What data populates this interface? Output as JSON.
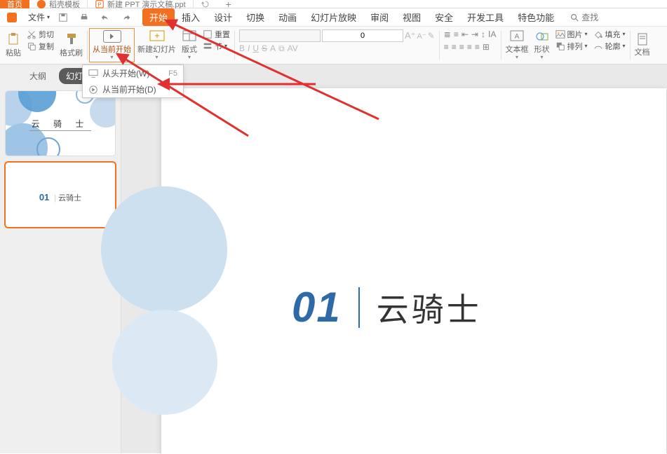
{
  "tabs": {
    "home": "首页",
    "template": "稻壳模板",
    "doc": "新建 PPT 演示文稿.ppt"
  },
  "filemenu": {
    "label": "文件"
  },
  "menutabs": {
    "start": "开始",
    "insert": "插入",
    "design": "设计",
    "transition": "切换",
    "animation": "动画",
    "slideshow": "幻灯片放映",
    "review": "审阅",
    "view": "视图",
    "security": "安全",
    "devtools": "开发工具",
    "special": "特色功能"
  },
  "search": {
    "label": "查找"
  },
  "ribbon": {
    "cut": "剪切",
    "copy": "复制",
    "paste": "粘贴",
    "format_painter": "格式刷",
    "from_current": "从当前开始",
    "new_slide": "新建幻灯片",
    "layout": "版式",
    "reset": "重置",
    "section": "节",
    "font_size": "0",
    "textbox": "文本框",
    "shapes": "形状",
    "picture": "图片",
    "arrange": "排列",
    "fill": "填充",
    "outline": "轮廓",
    "doc_assist": "文档"
  },
  "dropmenu": {
    "from_start": "从头开始(W)",
    "from_start_sc": "F5",
    "from_current": "从当前开始(D)"
  },
  "leftpane": {
    "outline_tab": "大纲",
    "slides_tab": "幻灯片",
    "thumb1_text": "云 骑 士",
    "thumb2_num": "01",
    "thumb2_text": "云骑士"
  },
  "slide": {
    "num": "01",
    "title": "云骑士"
  }
}
